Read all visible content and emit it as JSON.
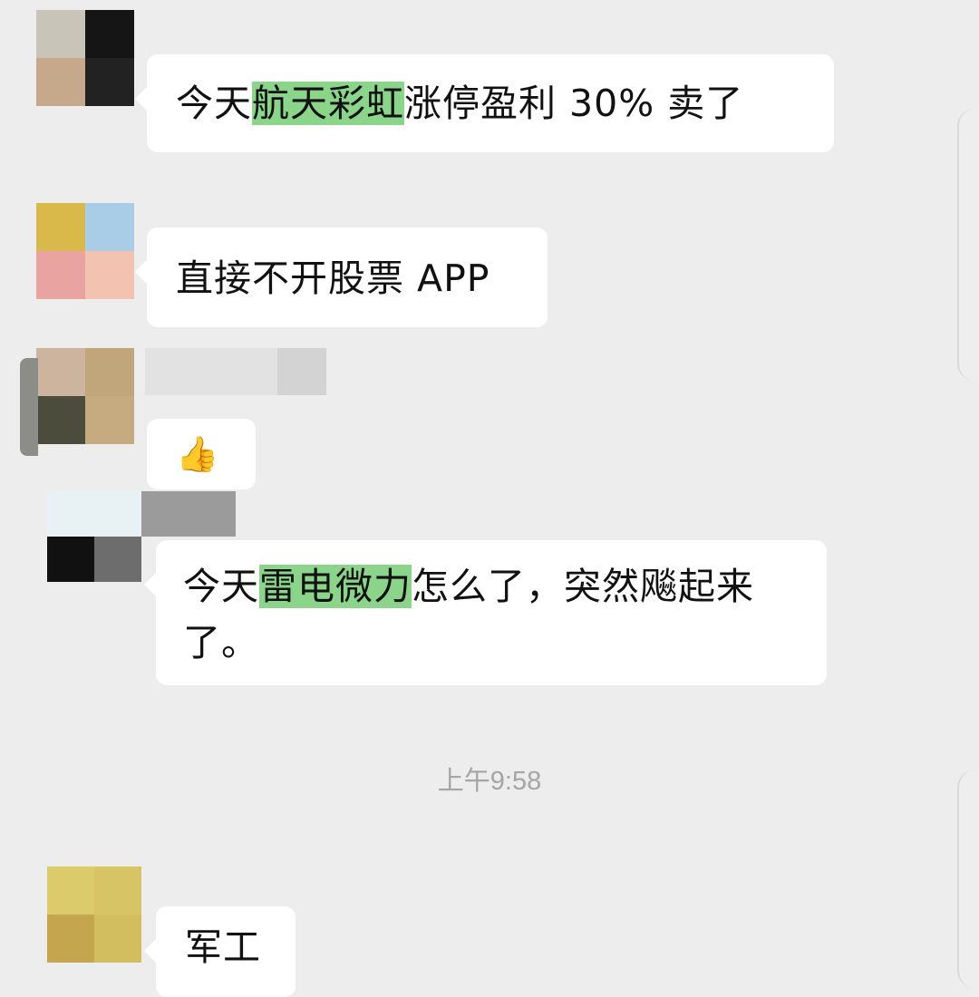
{
  "messages": [
    {
      "parts": [
        {
          "text": "今天",
          "highlight": false
        },
        {
          "text": "航天彩虹",
          "highlight": true
        },
        {
          "text": "涨停盈利 30% 卖了",
          "highlight": false
        }
      ]
    },
    {
      "parts": [
        {
          "text": "直接不开股票 APP",
          "highlight": false
        }
      ]
    },
    {
      "emoji": "👍"
    },
    {
      "parts": [
        {
          "text": "今天",
          "highlight": false
        },
        {
          "text": "雷电微力",
          "highlight": true
        },
        {
          "text": "怎么了，突然飚起来",
          "highlight": false
        }
      ],
      "line2": "了。"
    },
    {
      "parts": [
        {
          "text": "军工",
          "highlight": false
        }
      ]
    }
  ],
  "timestamp": "上午9:58",
  "colors": {
    "background": "#ededed",
    "bubble": "#ffffff",
    "highlight": "#8ad58a",
    "timestamp": "#a5a5a5"
  }
}
